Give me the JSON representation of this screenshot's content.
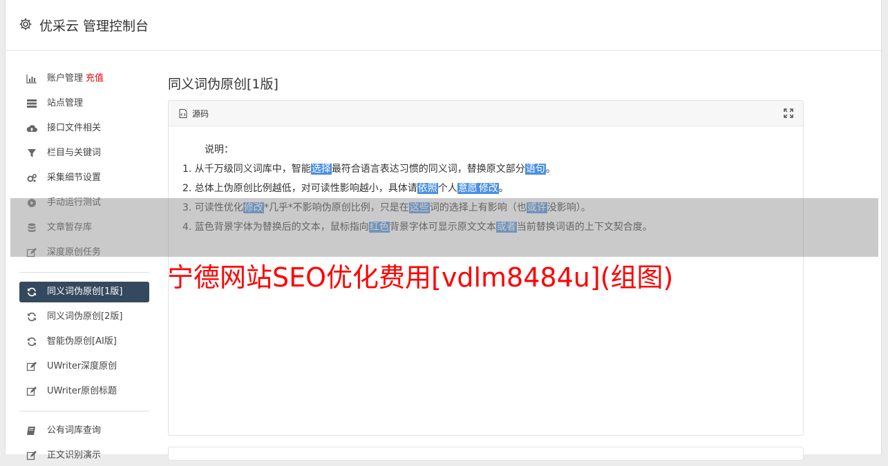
{
  "app": {
    "title": "优采云 管理控制台"
  },
  "sidebar": {
    "items": [
      {
        "label": "账户管理",
        "icon": "bar-chart-icon",
        "badge": "充值"
      },
      {
        "label": "站点管理",
        "icon": "server-icon"
      },
      {
        "label": "接口文件相关",
        "icon": "cloud-upload-icon"
      },
      {
        "label": "栏目与关键词",
        "icon": "filter-icon"
      },
      {
        "label": "采集细节设置",
        "icon": "cogs-icon"
      },
      {
        "label": "手动运行测试",
        "icon": "play-circle-icon"
      },
      {
        "label": "文章暂存库",
        "icon": "database-icon"
      },
      {
        "label": "深度原创任务",
        "icon": "edit-icon"
      },
      {
        "label": "同义词伪原创[1版]",
        "icon": "refresh-icon",
        "active": true
      },
      {
        "label": "同义词伪原创[2版]",
        "icon": "refresh-icon"
      },
      {
        "label": "智能伪原创[AI版]",
        "icon": "refresh-icon"
      },
      {
        "label": "UWriter深度原创",
        "icon": "edit-icon"
      },
      {
        "label": "UWriter原创标题",
        "icon": "edit-icon"
      },
      {
        "label": "公有词库查询",
        "icon": "book-icon"
      },
      {
        "label": "正文识别演示",
        "icon": "edit-icon"
      }
    ]
  },
  "main": {
    "title": "同义词伪原创[1版]",
    "panel": {
      "header_label": "源码",
      "intro": "说明：",
      "lines": [
        [
          "1. 从千万级同义词库中，智能",
          {
            "hl": "选择"
          },
          "最符合语言表达习惯的同义词，替换原文部分",
          {
            "hl": "语句"
          },
          "。"
        ],
        [
          "2. 总体上伪原创比例越低，对可读性影响越小，具体请",
          {
            "hl": "依照"
          },
          "个人",
          {
            "hl": "意愿"
          },
          {
            "hl": "修改"
          },
          "。"
        ],
        [
          "3. 可读性优化",
          {
            "hl": "修改"
          },
          "*几乎*不影响伪原创比例，只是在",
          {
            "hl": "这些"
          },
          "词的选择上有影响（也",
          {
            "hl": "或许"
          },
          "没影响）。"
        ],
        [
          "4. 蓝色背景字体为替换后的文本，鼠标指向",
          {
            "hl": "红色"
          },
          "背景字体可显示原文文本",
          {
            "hl": "或者"
          },
          "当前替换词语的上下文契合度。"
        ]
      ]
    }
  },
  "watermark": {
    "text": "宁德网站SEO优化费用[vdlm8484u](组图)",
    "color": "#ff0000"
  },
  "colors": {
    "sidebar_active_bg": "#34495e",
    "highlight": "#4a90e2",
    "recharge": "#ee0000"
  }
}
